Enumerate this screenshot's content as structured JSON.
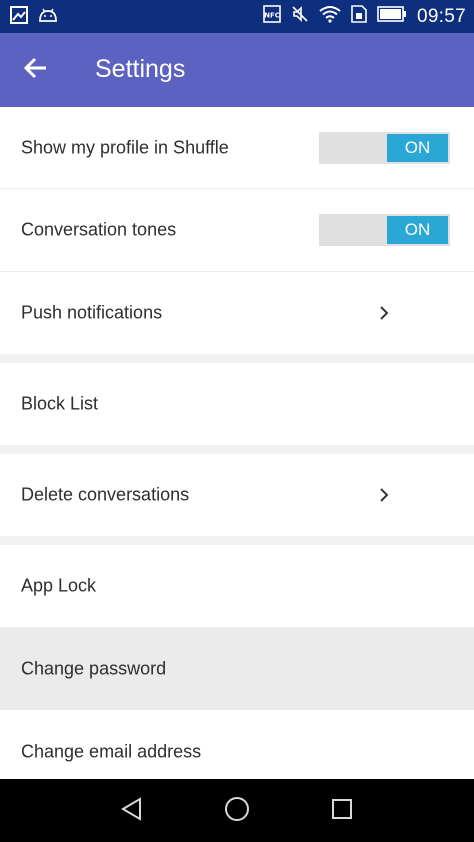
{
  "status_bar": {
    "time": "09:57",
    "icons": [
      "gallery-icon",
      "android-icon",
      "nfc-icon",
      "silent-icon",
      "wifi-icon",
      "sim-icon",
      "battery-icon"
    ],
    "nfc_label": "NFC"
  },
  "app_bar": {
    "title": "Settings",
    "back_icon": "arrow-left-icon"
  },
  "settings": {
    "show_profile": {
      "label": "Show my profile in Shuffle",
      "toggle": "ON"
    },
    "conversation_tones": {
      "label": "Conversation tones",
      "toggle": "ON"
    },
    "push_notifications": {
      "label": "Push notifications"
    },
    "block_list": {
      "label": "Block List"
    },
    "delete_conversations": {
      "label": "Delete conversations"
    },
    "app_lock": {
      "label": "App Lock"
    },
    "change_password": {
      "label": "Change password"
    },
    "change_email": {
      "label": "Change email address"
    }
  },
  "colors": {
    "status_bar": "#0d2f7d",
    "app_bar": "#5c62bf",
    "toggle_on": "#2aa7d4",
    "toggle_track": "#e0e0e0",
    "highlight_row": "#ebebeb",
    "section_gap": "#f1f1f1"
  },
  "nav_bar": {
    "icons": [
      "back-triangle-icon",
      "home-circle-icon",
      "recents-square-icon"
    ]
  }
}
